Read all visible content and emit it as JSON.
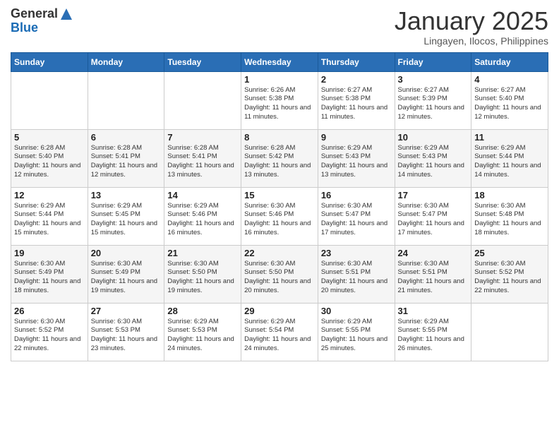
{
  "header": {
    "logo_general": "General",
    "logo_blue": "Blue",
    "month_title": "January 2025",
    "subtitle": "Lingayen, Ilocos, Philippines"
  },
  "weekdays": [
    "Sunday",
    "Monday",
    "Tuesday",
    "Wednesday",
    "Thursday",
    "Friday",
    "Saturday"
  ],
  "weeks": [
    [
      {
        "day": "",
        "sunrise": "",
        "sunset": "",
        "daylight": ""
      },
      {
        "day": "",
        "sunrise": "",
        "sunset": "",
        "daylight": ""
      },
      {
        "day": "",
        "sunrise": "",
        "sunset": "",
        "daylight": ""
      },
      {
        "day": "1",
        "sunrise": "Sunrise: 6:26 AM",
        "sunset": "Sunset: 5:38 PM",
        "daylight": "Daylight: 11 hours and 11 minutes."
      },
      {
        "day": "2",
        "sunrise": "Sunrise: 6:27 AM",
        "sunset": "Sunset: 5:38 PM",
        "daylight": "Daylight: 11 hours and 11 minutes."
      },
      {
        "day": "3",
        "sunrise": "Sunrise: 6:27 AM",
        "sunset": "Sunset: 5:39 PM",
        "daylight": "Daylight: 11 hours and 12 minutes."
      },
      {
        "day": "4",
        "sunrise": "Sunrise: 6:27 AM",
        "sunset": "Sunset: 5:40 PM",
        "daylight": "Daylight: 11 hours and 12 minutes."
      }
    ],
    [
      {
        "day": "5",
        "sunrise": "Sunrise: 6:28 AM",
        "sunset": "Sunset: 5:40 PM",
        "daylight": "Daylight: 11 hours and 12 minutes."
      },
      {
        "day": "6",
        "sunrise": "Sunrise: 6:28 AM",
        "sunset": "Sunset: 5:41 PM",
        "daylight": "Daylight: 11 hours and 12 minutes."
      },
      {
        "day": "7",
        "sunrise": "Sunrise: 6:28 AM",
        "sunset": "Sunset: 5:41 PM",
        "daylight": "Daylight: 11 hours and 13 minutes."
      },
      {
        "day": "8",
        "sunrise": "Sunrise: 6:28 AM",
        "sunset": "Sunset: 5:42 PM",
        "daylight": "Daylight: 11 hours and 13 minutes."
      },
      {
        "day": "9",
        "sunrise": "Sunrise: 6:29 AM",
        "sunset": "Sunset: 5:43 PM",
        "daylight": "Daylight: 11 hours and 13 minutes."
      },
      {
        "day": "10",
        "sunrise": "Sunrise: 6:29 AM",
        "sunset": "Sunset: 5:43 PM",
        "daylight": "Daylight: 11 hours and 14 minutes."
      },
      {
        "day": "11",
        "sunrise": "Sunrise: 6:29 AM",
        "sunset": "Sunset: 5:44 PM",
        "daylight": "Daylight: 11 hours and 14 minutes."
      }
    ],
    [
      {
        "day": "12",
        "sunrise": "Sunrise: 6:29 AM",
        "sunset": "Sunset: 5:44 PM",
        "daylight": "Daylight: 11 hours and 15 minutes."
      },
      {
        "day": "13",
        "sunrise": "Sunrise: 6:29 AM",
        "sunset": "Sunset: 5:45 PM",
        "daylight": "Daylight: 11 hours and 15 minutes."
      },
      {
        "day": "14",
        "sunrise": "Sunrise: 6:29 AM",
        "sunset": "Sunset: 5:46 PM",
        "daylight": "Daylight: 11 hours and 16 minutes."
      },
      {
        "day": "15",
        "sunrise": "Sunrise: 6:30 AM",
        "sunset": "Sunset: 5:46 PM",
        "daylight": "Daylight: 11 hours and 16 minutes."
      },
      {
        "day": "16",
        "sunrise": "Sunrise: 6:30 AM",
        "sunset": "Sunset: 5:47 PM",
        "daylight": "Daylight: 11 hours and 17 minutes."
      },
      {
        "day": "17",
        "sunrise": "Sunrise: 6:30 AM",
        "sunset": "Sunset: 5:47 PM",
        "daylight": "Daylight: 11 hours and 17 minutes."
      },
      {
        "day": "18",
        "sunrise": "Sunrise: 6:30 AM",
        "sunset": "Sunset: 5:48 PM",
        "daylight": "Daylight: 11 hours and 18 minutes."
      }
    ],
    [
      {
        "day": "19",
        "sunrise": "Sunrise: 6:30 AM",
        "sunset": "Sunset: 5:49 PM",
        "daylight": "Daylight: 11 hours and 18 minutes."
      },
      {
        "day": "20",
        "sunrise": "Sunrise: 6:30 AM",
        "sunset": "Sunset: 5:49 PM",
        "daylight": "Daylight: 11 hours and 19 minutes."
      },
      {
        "day": "21",
        "sunrise": "Sunrise: 6:30 AM",
        "sunset": "Sunset: 5:50 PM",
        "daylight": "Daylight: 11 hours and 19 minutes."
      },
      {
        "day": "22",
        "sunrise": "Sunrise: 6:30 AM",
        "sunset": "Sunset: 5:50 PM",
        "daylight": "Daylight: 11 hours and 20 minutes."
      },
      {
        "day": "23",
        "sunrise": "Sunrise: 6:30 AM",
        "sunset": "Sunset: 5:51 PM",
        "daylight": "Daylight: 11 hours and 20 minutes."
      },
      {
        "day": "24",
        "sunrise": "Sunrise: 6:30 AM",
        "sunset": "Sunset: 5:51 PM",
        "daylight": "Daylight: 11 hours and 21 minutes."
      },
      {
        "day": "25",
        "sunrise": "Sunrise: 6:30 AM",
        "sunset": "Sunset: 5:52 PM",
        "daylight": "Daylight: 11 hours and 22 minutes."
      }
    ],
    [
      {
        "day": "26",
        "sunrise": "Sunrise: 6:30 AM",
        "sunset": "Sunset: 5:52 PM",
        "daylight": "Daylight: 11 hours and 22 minutes."
      },
      {
        "day": "27",
        "sunrise": "Sunrise: 6:30 AM",
        "sunset": "Sunset: 5:53 PM",
        "daylight": "Daylight: 11 hours and 23 minutes."
      },
      {
        "day": "28",
        "sunrise": "Sunrise: 6:29 AM",
        "sunset": "Sunset: 5:53 PM",
        "daylight": "Daylight: 11 hours and 24 minutes."
      },
      {
        "day": "29",
        "sunrise": "Sunrise: 6:29 AM",
        "sunset": "Sunset: 5:54 PM",
        "daylight": "Daylight: 11 hours and 24 minutes."
      },
      {
        "day": "30",
        "sunrise": "Sunrise: 6:29 AM",
        "sunset": "Sunset: 5:55 PM",
        "daylight": "Daylight: 11 hours and 25 minutes."
      },
      {
        "day": "31",
        "sunrise": "Sunrise: 6:29 AM",
        "sunset": "Sunset: 5:55 PM",
        "daylight": "Daylight: 11 hours and 26 minutes."
      },
      {
        "day": "",
        "sunrise": "",
        "sunset": "",
        "daylight": ""
      }
    ]
  ]
}
